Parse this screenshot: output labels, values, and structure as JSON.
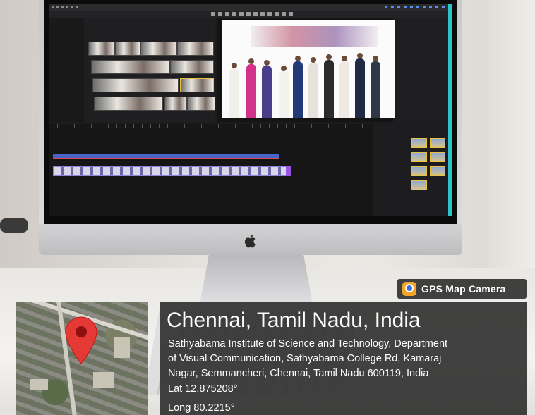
{
  "overlay": {
    "app_name": "GPS Map Camera",
    "location_title": "Chennai, Tamil Nadu, India",
    "address_lines": [
      "Sathyabama Institute of Science and Technology, Department",
      "of Visual Communication, Sathyabama College Rd, Kamaraj",
      "Nagar, Semmancheri, Chennai, Tamil Nadu 600119, India"
    ],
    "latitude": "Lat 12.875208°",
    "longitude": "Long 80.2215°"
  },
  "icons": {
    "app": "gps-map-camera-icon",
    "pin": "map-pin-icon",
    "brand": "apple-logo-icon"
  },
  "colors": {
    "pin": "#e53935",
    "overlay_bg": "#2d2d2d",
    "timeline_track": "#4a63c9"
  }
}
